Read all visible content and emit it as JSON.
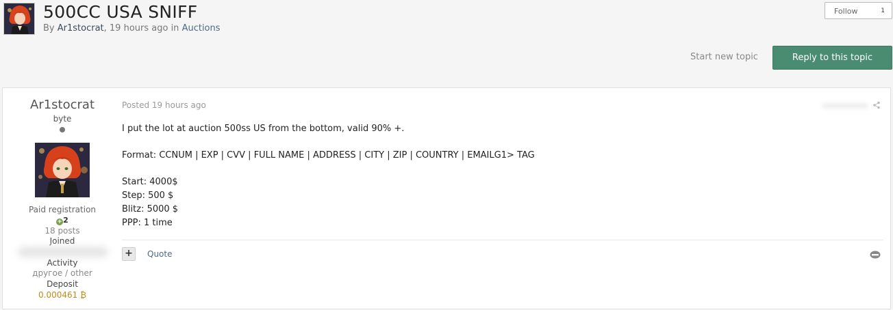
{
  "topic": {
    "title": "500CC USA SNIFF",
    "by_prefix": "By ",
    "author": "Ar1stocrat",
    "time_part": ", 19 hours ago in ",
    "forum": "Auctions"
  },
  "follow": {
    "label": "Follow",
    "count": "1"
  },
  "actions": {
    "start_new_topic": "Start new topic",
    "reply": "Reply to this topic"
  },
  "post_author": {
    "name": "Ar1stocrat",
    "rank": "byte",
    "group": "Paid registration",
    "reputation": "2",
    "posts": "18 posts",
    "joined_label": "Joined",
    "activity_label": "Activity",
    "activity_value": "другое / other",
    "deposit_label": "Deposit",
    "deposit_value": "0.000461 ₿"
  },
  "post": {
    "posted": "Posted 19 hours ago",
    "lines": [
      "I put the lot at auction 500ss US from the bottom, valid 90% +.",
      "Format: CCNUM | EXP | CVV | FULL NAME | ADDRESS | CITY | ZIP | COUNTRY | EMAILG1> TAG",
      "Start: 4000$",
      "Step: 500 $",
      "Blitz: 5000 $",
      "PPP: 1 time"
    ],
    "quote_label": "Quote",
    "plus_label": "+"
  },
  "icons": {
    "share": "share-icon",
    "report": "report-icon",
    "online": "online-status-icon",
    "reputation": "reputation-plus-icon"
  },
  "colors": {
    "accent": "#4a8c72",
    "link": "#4a6a8a",
    "deposit": "#c08a14"
  }
}
